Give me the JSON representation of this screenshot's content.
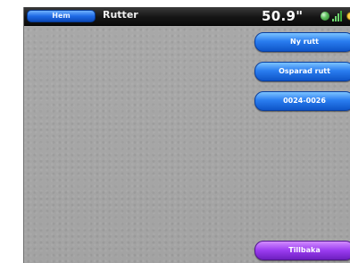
{
  "header": {
    "home_label": "Hem",
    "title": "Rutter",
    "depth_value": "50.9\"",
    "status_icons": [
      "gps-icon",
      "signal-icon",
      "settings-icon"
    ]
  },
  "menu": {
    "buttons": [
      {
        "label": "Ny rutt"
      },
      {
        "label": "Osparad rutt"
      },
      {
        "label": "0024-0026"
      }
    ],
    "back_label": "Tillbaka"
  },
  "colors": {
    "screen_bg": "#a6a6a6",
    "header_bg": "#151515",
    "button_blue": "#2a7df0",
    "button_purple": "#9a3bf0"
  }
}
